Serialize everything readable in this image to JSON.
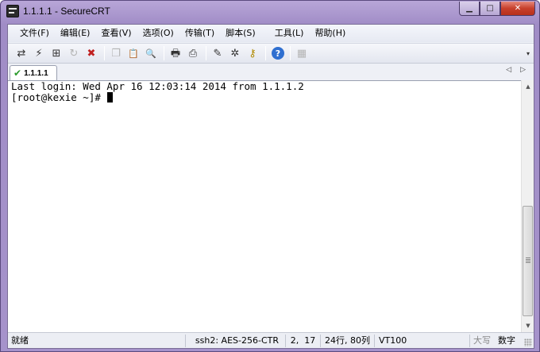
{
  "window": {
    "title": "1.1.1.1 - SecureCRT",
    "minimize": "▁",
    "maximize": "□",
    "close": "✕"
  },
  "menu": [
    {
      "label": "文件(F)"
    },
    {
      "label": "编辑(E)"
    },
    {
      "label": "查看(V)"
    },
    {
      "label": "选项(O)"
    },
    {
      "label": "传输(T)"
    },
    {
      "label": "脚本(S)"
    },
    {
      "label": "工具(L)"
    },
    {
      "label": "帮助(H)"
    }
  ],
  "toolbar": {
    "icons": [
      {
        "name": "connect-icon",
        "glyph": "⇄",
        "enabled": true
      },
      {
        "name": "quick-connect-icon",
        "glyph": "⚡",
        "enabled": true
      },
      {
        "name": "connect-in-tab-icon",
        "glyph": "⊞",
        "enabled": true
      },
      {
        "name": "reconnect-icon",
        "glyph": "↻",
        "enabled": false
      },
      {
        "name": "disconnect-icon",
        "glyph": "✖",
        "enabled": true
      },
      {
        "name": "copy-icon",
        "glyph": "❐",
        "enabled": false
      },
      {
        "name": "paste-icon",
        "glyph": "📋",
        "enabled": false
      },
      {
        "name": "find-icon",
        "glyph": "🔍",
        "enabled": true
      },
      {
        "name": "print-icon",
        "glyph": "🖶",
        "enabled": true
      },
      {
        "name": "print-setup-icon",
        "glyph": "⎙",
        "enabled": true
      },
      {
        "name": "session-options-icon",
        "glyph": "✎",
        "enabled": true
      },
      {
        "name": "global-options-icon",
        "glyph": "✲",
        "enabled": true
      },
      {
        "name": "key-manager-icon",
        "glyph": "⚷",
        "enabled": true
      },
      {
        "name": "help-icon",
        "glyph": "?",
        "enabled": true
      },
      {
        "name": "keymap-icon",
        "glyph": "▦",
        "enabled": false
      }
    ]
  },
  "tabs": [
    {
      "label": "1.1.1.1",
      "status_icon": "check-icon",
      "active": true
    }
  ],
  "terminal": {
    "lines": [
      "Last login: Wed Apr 16 12:03:14 2014 from 1.1.1.2",
      "[root@kexie ~]# "
    ]
  },
  "statusbar": {
    "ready": "就绪",
    "cipher": "ssh2: AES-256-CTR",
    "cursor_pos": "2,  17",
    "rows_cols": "24行, 80列",
    "terminal_type": "VT100",
    "caps": "大写",
    "num": "数字"
  },
  "colors": {
    "titlebar": "#a693cb",
    "terminal_bg": "#ffffff",
    "tab_check": "#2a9a2a"
  }
}
